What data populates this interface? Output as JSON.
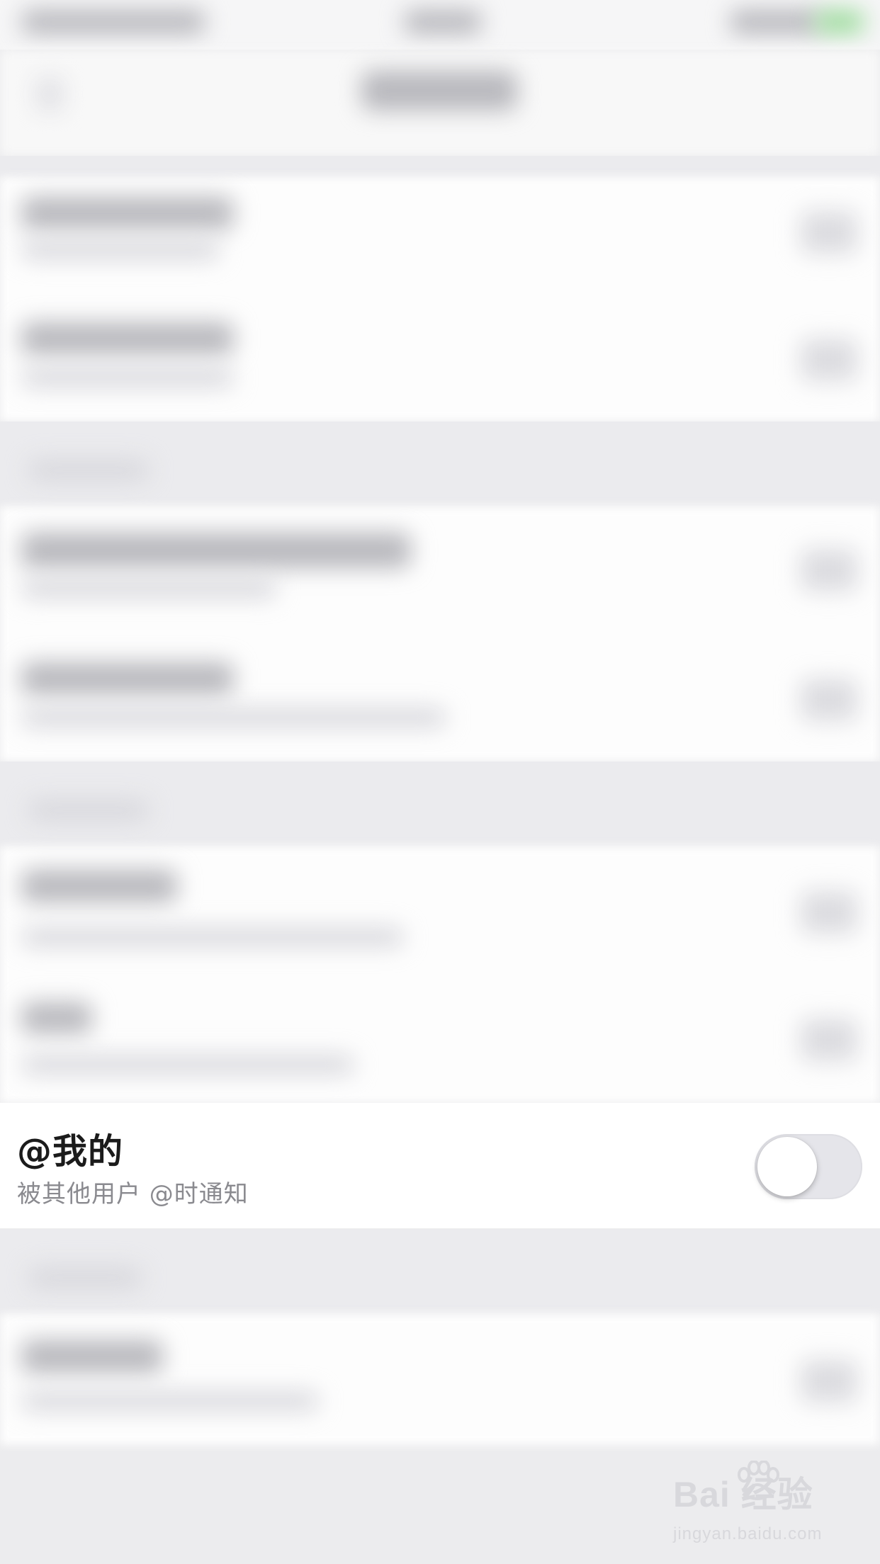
{
  "focus_item": {
    "title": "@我的",
    "subtitle": "被其他用户 @时通知",
    "toggle_state": "off"
  },
  "watermark": {
    "logo_text": "Bai  经验",
    "url_text": "jingyan.baidu.com"
  },
  "icons": [
    "toggle-switch",
    "baidu-paw-logo"
  ]
}
